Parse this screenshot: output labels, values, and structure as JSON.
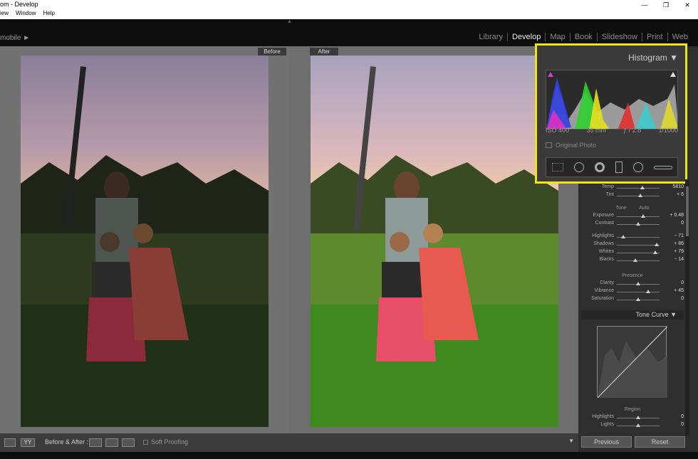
{
  "window": {
    "title": "om - Develop",
    "controls": [
      "—",
      "❐",
      "✕"
    ]
  },
  "menu": [
    "iew",
    "Window",
    "Help"
  ],
  "identity_plate": "mobile ►",
  "modules": {
    "items": [
      "Library",
      "Develop",
      "Map",
      "Book",
      "Slideshow",
      "Print",
      "Web"
    ],
    "active": "Develop"
  },
  "viewer": {
    "before_label": "Before",
    "after_label": "After"
  },
  "histogram": {
    "title": "Histogram",
    "iso": "ISO 400",
    "focal": "35 mm",
    "aperture": "ƒ / 2.8",
    "shutter": "1/1000",
    "original_photo": "Original Photo"
  },
  "basic": {
    "wb": [
      {
        "name": "Temp",
        "val": "5810",
        "pos": 0.6
      },
      {
        "name": "Tint",
        "val": "+ 6",
        "pos": 0.55
      }
    ],
    "tone_label": "Tone",
    "auto_label": "Auto",
    "tone": [
      {
        "name": "Exposure",
        "val": "+ 0.48",
        "pos": 0.62
      },
      {
        "name": "Contrast",
        "val": "0",
        "pos": 0.5
      }
    ],
    "tone2": [
      {
        "name": "Highlights",
        "val": "− 71",
        "pos": 0.15
      },
      {
        "name": "Shadows",
        "val": "+ 86",
        "pos": 0.93
      },
      {
        "name": "Whites",
        "val": "+ 79",
        "pos": 0.9
      },
      {
        "name": "Blacks",
        "val": "− 14",
        "pos": 0.43
      }
    ],
    "presence_label": "Presence",
    "presence": [
      {
        "name": "Clarity",
        "val": "0",
        "pos": 0.5
      },
      {
        "name": "Vibrance",
        "val": "+ 45",
        "pos": 0.73
      },
      {
        "name": "Saturation",
        "val": "0",
        "pos": 0.5
      }
    ]
  },
  "tone_curve": {
    "title": "Tone Curve",
    "region_label": "Region",
    "rows": [
      {
        "name": "Highlights",
        "val": "0",
        "pos": 0.5
      },
      {
        "name": "Lights",
        "val": "0",
        "pos": 0.5
      }
    ]
  },
  "toolbar": {
    "before_after": "Before & After :",
    "yy": "YY",
    "soft_proofing": "Soft Proofing"
  },
  "buttons": {
    "previous": "Previous",
    "reset": "Reset"
  },
  "colors": {
    "highlight_box": "#f2e21a",
    "panel": "#2f2f2f"
  }
}
